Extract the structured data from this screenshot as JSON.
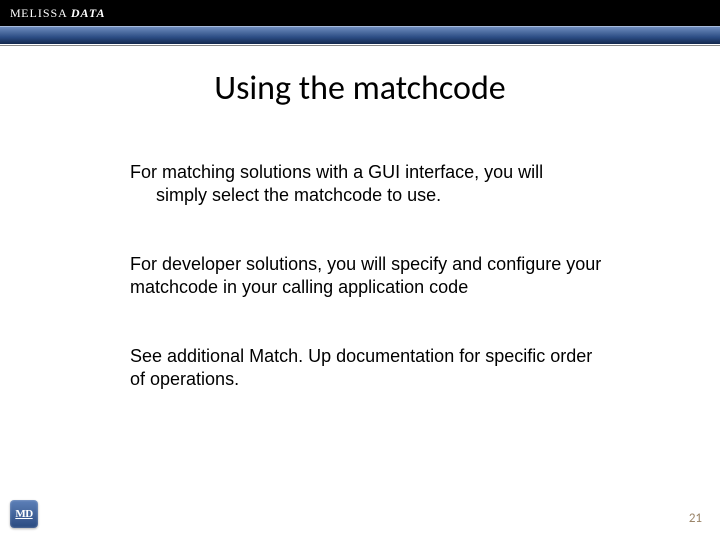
{
  "brand": {
    "prefix": "M",
    "name": "ELISSA",
    "suffix": "DATA"
  },
  "title": "Using the matchcode",
  "paragraphs": {
    "p1a": "For matching solutions with a GUI interface, you will",
    "p1b": "simply select the matchcode to use.",
    "p2": "For developer solutions, you will specify and configure your matchcode in your calling application code",
    "p3": "See additional Match. Up documentation for specific order of operations."
  },
  "badge": "MD",
  "page_number": "21"
}
